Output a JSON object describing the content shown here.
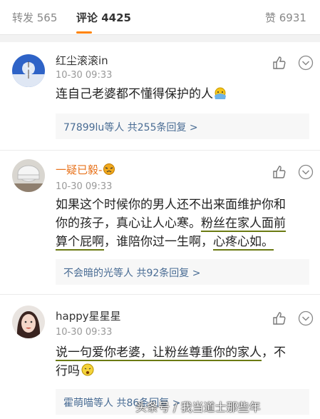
{
  "tabs": {
    "repost": "转发 565",
    "comments": "评论 4425",
    "likes": "赞 6931"
  },
  "comments": [
    {
      "username": "红尘滚滚in",
      "time": "10-30 09:33",
      "text": "连自己老婆都不懂得保护的人",
      "reply_summary": "77899lu等人  共255条回复 >"
    },
    {
      "username": "一疑已毅-",
      "time": "10-30 09:33",
      "text_line1": "如果这个时候你的男人还不出来面维护你和",
      "text_line2": "你的孩子，真心让人心寒。",
      "text_line2_hl": "粉丝在家人面前",
      "text_line3_hl1": "算个屁啊",
      "text_line3_mid": "，谁陪你过一生啊，",
      "text_line3_hl2": "心疼心如。",
      "reply_summary": "不会暗的光等人  共92条回复 >"
    },
    {
      "username": "happy星星星",
      "time": "10-30 09:33",
      "text_hl": "说一句爱你老婆，让粉丝尊重你的家人",
      "text_tail": "，不",
      "text_line2": "行吗",
      "reply_summary": "霍萌喵等人  共86条回复 >"
    }
  ],
  "watermark": "头条号 / 我当道士那些年",
  "colors": {
    "accent": "#ff8200",
    "link": "#496c94",
    "highlight_underline": "#6b7a12"
  },
  "icons": [
    "thumbs-up-icon",
    "chevron-down-icon",
    "emoji-icon"
  ]
}
